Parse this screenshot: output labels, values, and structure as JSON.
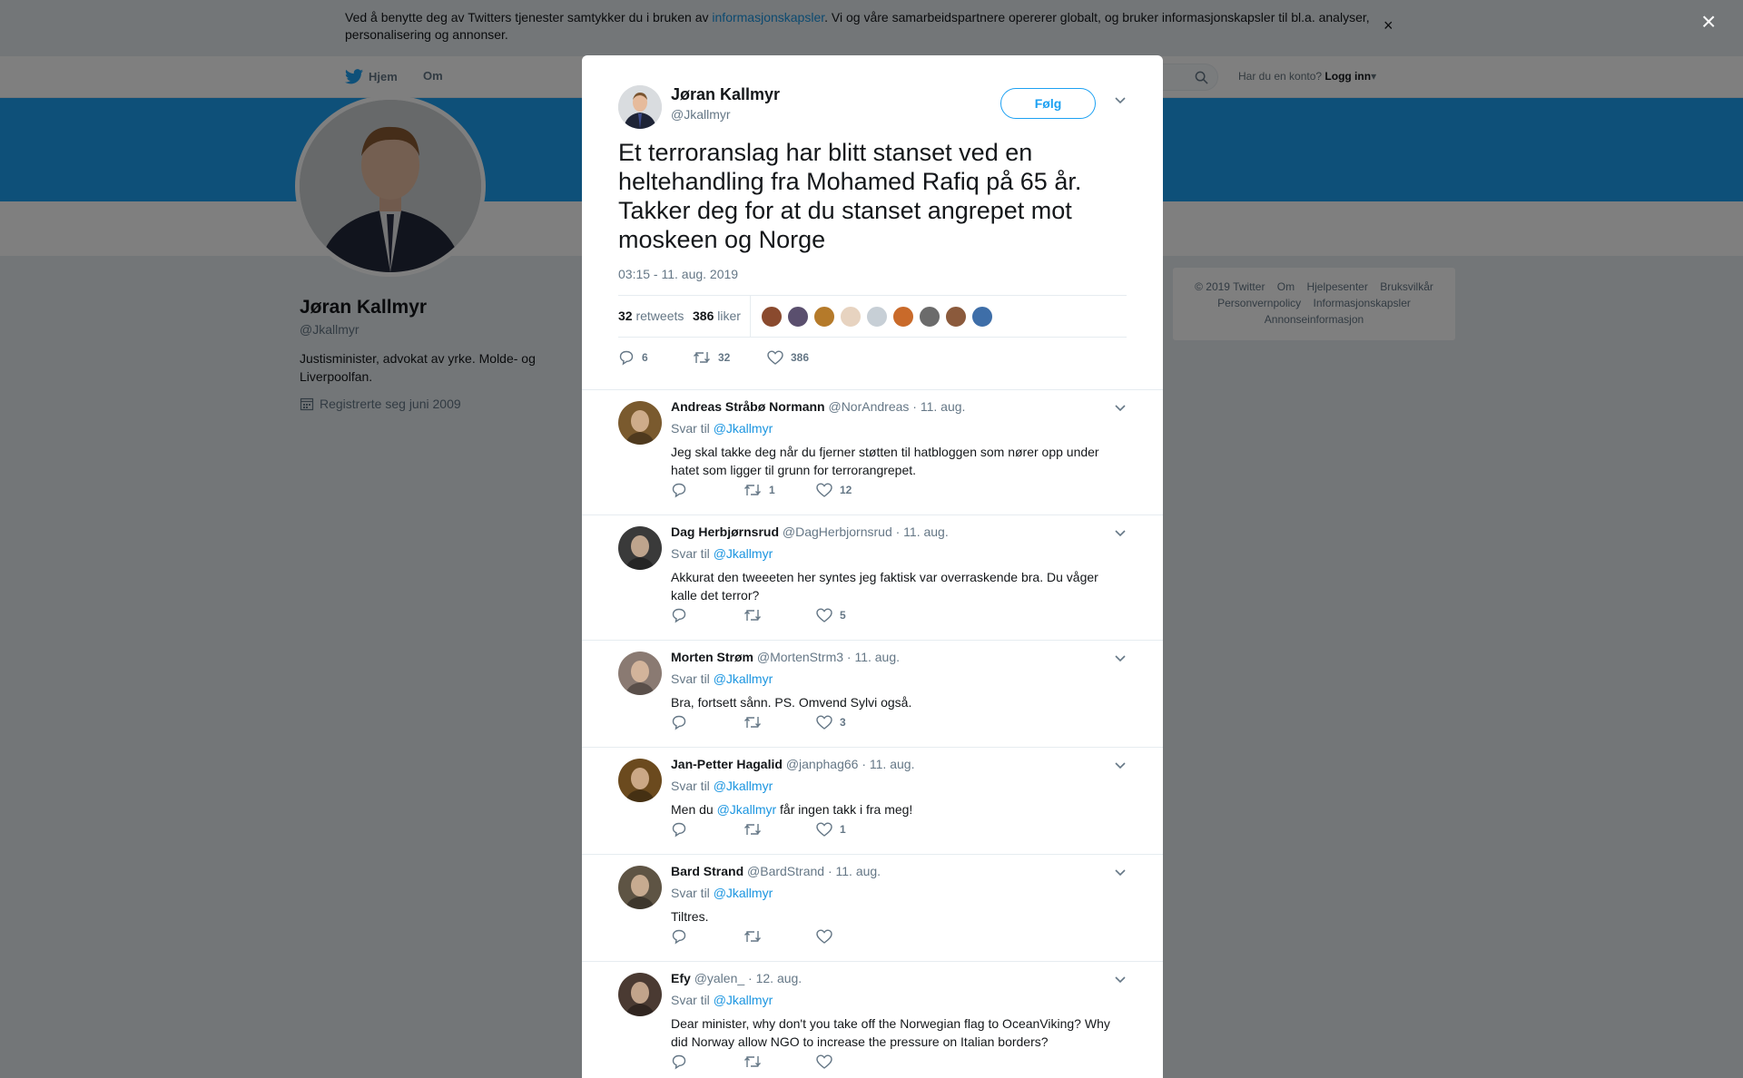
{
  "cookie_banner": {
    "text_before": "Ved å benytte deg av Twitters tjenester samtykker du i bruken av ",
    "link": "informasjonskapsler",
    "text_after": ". Vi og våre samarbeidspartnere opererer globalt, og bruker informasjonskapsler til bl.a. analyser, personalisering og annonser.",
    "close": "×"
  },
  "nav": {
    "home": "Hjem",
    "about": "Om",
    "account_prompt": "Har du en konto?",
    "login": "Logg inn"
  },
  "profile": {
    "name": "Jøran Kallmyr",
    "handle": "@Jkallmyr",
    "bio": "Justisminister, advokat av yrke. Molde- og Liverpoolfan.",
    "joined": "Registrerte seg juni 2009"
  },
  "footer": {
    "links_row1": [
      "© 2019 Twitter",
      "Om",
      "Hjelpesenter",
      "Bruksvilkår"
    ],
    "links_row2": [
      "Personvernpolicy",
      "Informasjonskapsler"
    ],
    "links_row3": [
      "Annonseinformasjon"
    ]
  },
  "overlay_close": "×",
  "tweet": {
    "name": "Jøran Kallmyr",
    "handle": "@Jkallmyr",
    "follow": "Følg",
    "text": "Et terroranslag har blitt stanset ved en heltehandling fra Mohamed Rafiq på 65 år. Takker deg for at du stanset angrepet mot moskeen og Norge",
    "timestamp": "03:15 - 11. aug. 2019",
    "retweets_count": "32",
    "retweets_label": "retweets",
    "likes_count": "386",
    "likes_label": "liker",
    "liker_colors": [
      "#8a4a2e",
      "#5a4f6e",
      "#b57a2a",
      "#e7d3c0",
      "#c7cfd6",
      "#c96a2a",
      "#6b6b6b",
      "#8b5a3c",
      "#3e6ea8"
    ],
    "actions": {
      "replies": "6",
      "retweets": "32",
      "likes": "386"
    }
  },
  "replies": [
    {
      "name": "Andreas Stråbø Normann",
      "handle": "@NorAndreas",
      "date": "· 11. aug.",
      "reply_prefix": "Svar til",
      "reply_to": "@Jkallmyr",
      "text": "Jeg skal takke deg når du fjerner støtten til hatbloggen som nører opp under hatet som ligger til grunn for terrorangrepet.",
      "retweets": "1",
      "likes": "12",
      "avatar_color": "#7a5a2e"
    },
    {
      "name": "Dag Herbjørnsrud",
      "handle": "@DagHerbjornsrud",
      "date": "· 11. aug.",
      "reply_prefix": "Svar til",
      "reply_to": "@Jkallmyr",
      "text": "Akkurat den tweeeten her syntes jeg faktisk var overraskende bra. Du våger kalle det terror?",
      "retweets": "",
      "likes": "5",
      "avatar_color": "#3a3a3a"
    },
    {
      "name": "Morten Strøm",
      "handle": "@MortenStrm3",
      "date": "· 11. aug.",
      "reply_prefix": "Svar til",
      "reply_to": "@Jkallmyr",
      "text": "Bra, fortsett sånn. PS. Omvend Sylvi også.",
      "retweets": "",
      "likes": "3",
      "avatar_color": "#8a7a72"
    },
    {
      "name": "Jan-Petter Hagalid",
      "handle": "@janphag66",
      "date": "· 11. aug.",
      "reply_prefix": "Svar til",
      "reply_to": "@Jkallmyr",
      "text_before": "Men du ",
      "text_link": "@Jkallmyr",
      "text_after": " får ingen takk i fra meg!",
      "retweets": "",
      "likes": "1",
      "avatar_color": "#6b4a1e"
    },
    {
      "name": "Bard Strand",
      "handle": "@BardStrand",
      "date": "· 11. aug.",
      "reply_prefix": "Svar til",
      "reply_to": "@Jkallmyr",
      "text": "Tiltres.",
      "retweets": "",
      "likes": "",
      "avatar_color": "#5e5444"
    },
    {
      "name": "Efy",
      "handle": "@yalen_",
      "date": "· 12. aug.",
      "reply_prefix": "Svar til",
      "reply_to": "@Jkallmyr",
      "text": "Dear minister, why don't you take off the Norwegian flag to OceanViking? Why did Norway allow NGO to increase the pressure on Italian borders?",
      "retweets": "",
      "likes": "",
      "avatar_color": "#4a3a32"
    }
  ]
}
